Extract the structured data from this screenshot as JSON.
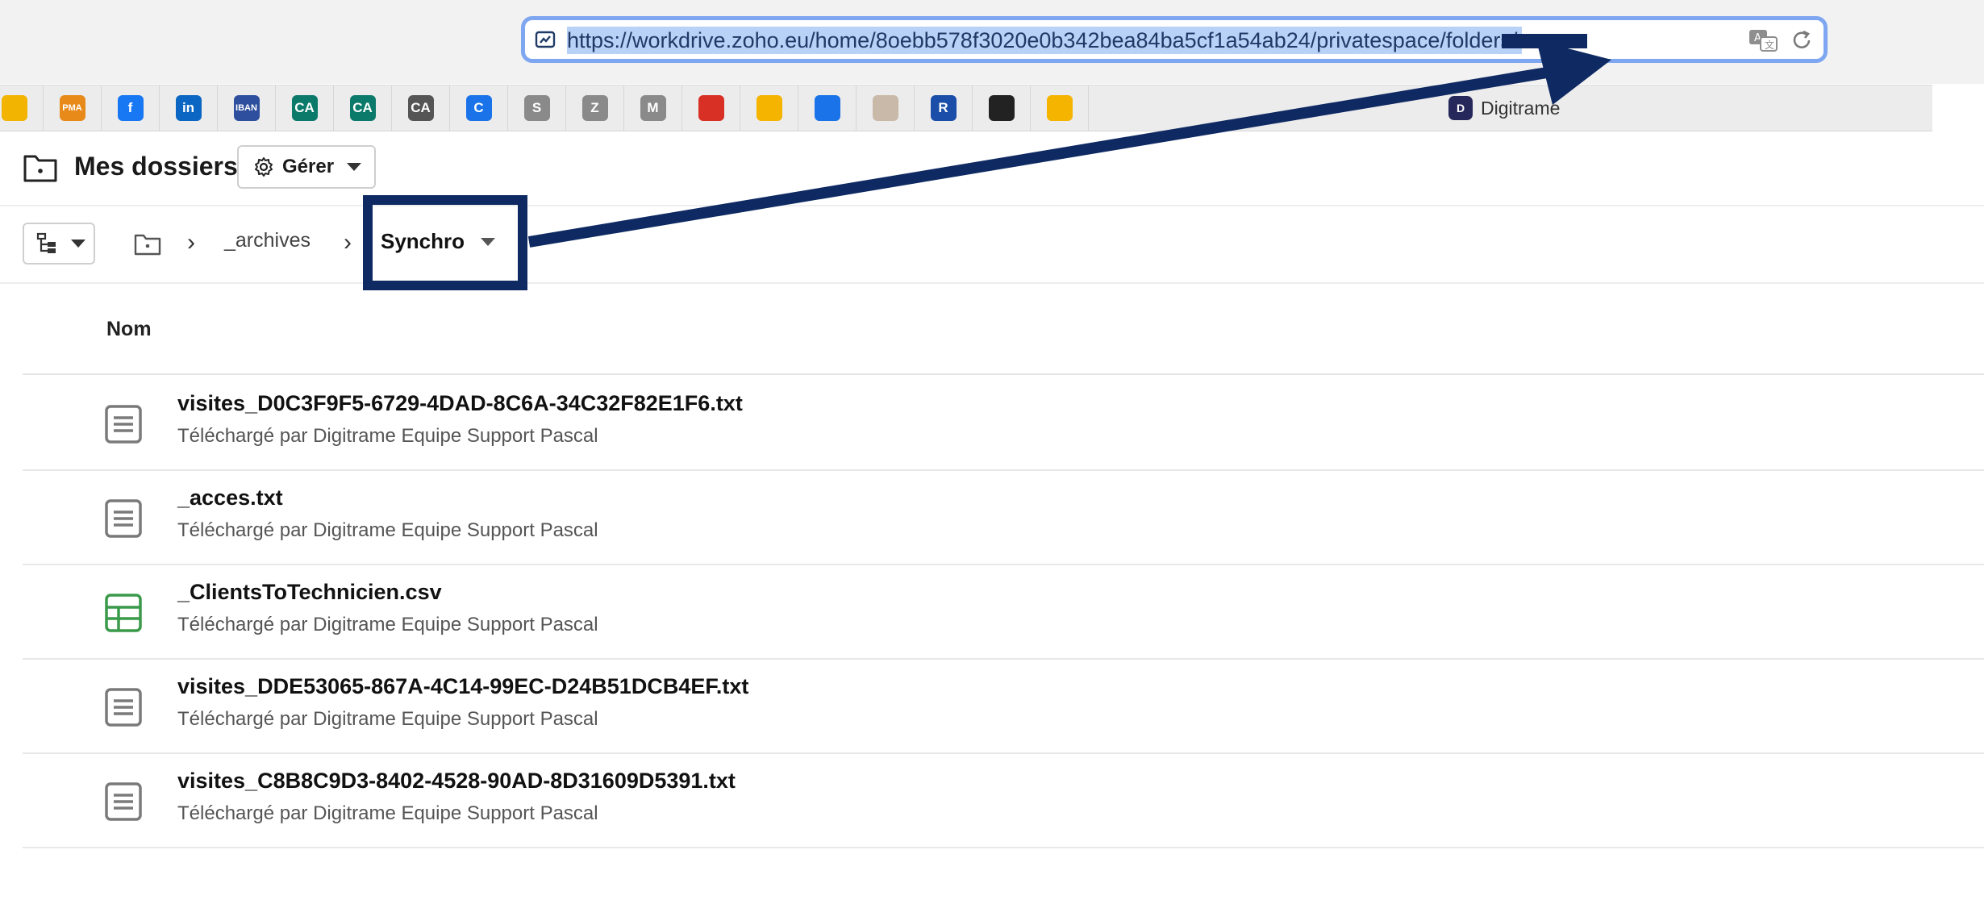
{
  "browser": {
    "url": "https://workdrive.zoho.eu/home/8oebb578f3020e0b342bea84ba5cf1a54ab24/privatespace/folders/",
    "bookmarks": [
      {
        "icon": "lightbulb-icon",
        "label": "",
        "color": "#f2b400"
      },
      {
        "icon": "pma-icon",
        "label": "PMA",
        "color": "#e88a1a"
      },
      {
        "icon": "facebook-icon",
        "label": "f",
        "color": "#1877f2"
      },
      {
        "icon": "linkedin-icon",
        "label": "in",
        "color": "#0a66c2"
      },
      {
        "icon": "iban-icon",
        "label": "IBAN",
        "color": "#2d4f9e"
      },
      {
        "icon": "credit-agricole-icon",
        "label": "CA",
        "color": "#0b7a6b"
      },
      {
        "icon": "credit-agricole-icon",
        "label": "CA",
        "color": "#0b7a6b"
      },
      {
        "icon": "credit-agricole-idf-icon",
        "label": "CA",
        "color": "#555555"
      },
      {
        "icon": "c-logo-icon",
        "label": "C",
        "color": "#1a73e8"
      },
      {
        "icon": "s-icon",
        "label": "S",
        "color": "#8a8a8a"
      },
      {
        "icon": "z-icon",
        "label": "Z",
        "color": "#8a8a8a"
      },
      {
        "icon": "m-icon",
        "label": "M",
        "color": "#8a8a8a"
      },
      {
        "icon": "megaphone-icon",
        "label": "",
        "color": "#d93025"
      },
      {
        "icon": "notes-icon",
        "label": "",
        "color": "#f5b400"
      },
      {
        "icon": "task-icon",
        "label": "",
        "color": "#1a73e8"
      },
      {
        "icon": "hc-icon",
        "label": "",
        "color": "#c9b9a8"
      },
      {
        "icon": "r-icon",
        "label": "R",
        "color": "#1a4ea8"
      },
      {
        "icon": "seagate-icon",
        "label": "",
        "color": "#222222"
      },
      {
        "icon": "slides-icon",
        "label": "",
        "color": "#f4b400"
      }
    ],
    "digitrame_bookmark": {
      "label": "Digitrame",
      "icon": "digitrame-logo-icon"
    }
  },
  "header": {
    "title": "Mes dossiers",
    "manage_label": "Gérer"
  },
  "breadcrumb": {
    "items": [
      "_archives"
    ],
    "current": "Synchro"
  },
  "list": {
    "column_name": "Nom",
    "files": [
      {
        "name": "visites_D0C3F9F5-6729-4DAD-8C6A-34C32F82E1F6.txt",
        "meta": "Téléchargé par Digitrame Equipe Support Pascal",
        "type": "text"
      },
      {
        "name": "_acces.txt",
        "meta": "Téléchargé par Digitrame Equipe Support Pascal",
        "type": "text"
      },
      {
        "name": "_ClientsToTechnicien.csv",
        "meta": "Téléchargé par Digitrame Equipe Support Pascal",
        "type": "spreadsheet"
      },
      {
        "name": "visites_DDE53065-867A-4C14-99EC-D24B51DCB4EF.txt",
        "meta": "Téléchargé par Digitrame Equipe Support Pascal",
        "type": "text"
      },
      {
        "name": "visites_C8B8C9D3-8402-4528-90AD-8D31609D5391.txt",
        "meta": "Téléchargé par Digitrame Equipe Support Pascal",
        "type": "text"
      }
    ]
  },
  "annotation": {
    "color": "#0f2a63"
  }
}
